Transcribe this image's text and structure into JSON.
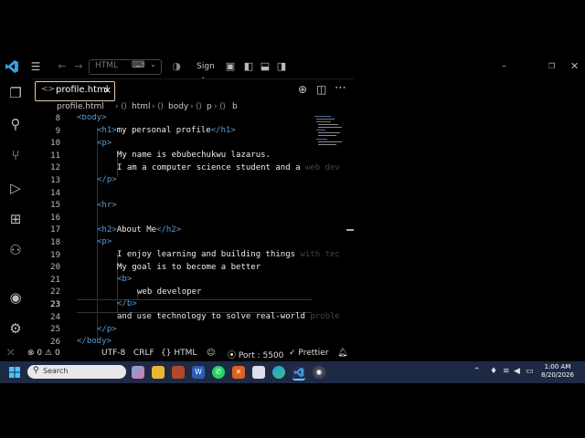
{
  "titlebar": {
    "command_center_label": "HTML",
    "signin_label": "Sign In",
    "icons": [
      "vscode-logo",
      "menu-icon",
      "back-arrow-icon",
      "forward-arrow-icon",
      "copilot-icon",
      "layout-icons",
      "minimize-icon",
      "maximize-icon",
      "close-icon"
    ]
  },
  "activity_bar": [
    "explorer-icon",
    "search-icon",
    "source-control-icon",
    "run-debug-icon",
    "extensions-icon",
    "python-icon",
    "account-icon",
    "settings-gear-icon"
  ],
  "tab": {
    "label": "profile.html",
    "icon": "<>",
    "close": "×"
  },
  "breadcrumb": [
    "profile.html",
    "html",
    "body",
    "p",
    "b"
  ],
  "editor": {
    "lines": [
      {
        "n": "8"
      },
      {
        "n": "9"
      },
      {
        "n": "10"
      },
      {
        "n": "11"
      },
      {
        "n": "12"
      },
      {
        "n": "13"
      },
      {
        "n": "14"
      },
      {
        "n": "15"
      },
      {
        "n": "16"
      },
      {
        "n": "17"
      },
      {
        "n": "18"
      },
      {
        "n": "19"
      },
      {
        "n": "20"
      },
      {
        "n": "21"
      },
      {
        "n": "22"
      },
      {
        "n": "23"
      },
      {
        "n": "24"
      },
      {
        "n": "25"
      },
      {
        "n": "26"
      }
    ],
    "code": {
      "l8_tag": "<body>",
      "l9_open": "<h1>",
      "l9_text": "my personal profile",
      "l9_close": "</h1>",
      "l10": "<p>",
      "l11": "My name is ebubechukwu lazarus.",
      "l12_visible": "I am a computer science student and a ",
      "l12_faded": "web dev",
      "l13": "</p>",
      "l15": "<hr>",
      "l17_open": "<h2>",
      "l17_text": "About Me",
      "l17_close": "</h2>",
      "l18": "<p>",
      "l19_visible": "I enjoy learning and building things ",
      "l19_faded": "with tec",
      "l20": "My goal is to become a better",
      "l21": "<b>",
      "l22": "web developer",
      "l23": "</b>",
      "l24_visible": "and use technology to solve real-world ",
      "l24_faded": "proble",
      "l25": "</p>",
      "l26": "</body>"
    },
    "active_line": "23"
  },
  "statusbar": {
    "errors": "0",
    "warnings": "0",
    "encoding": "UTF-8",
    "eol": "CRLF",
    "language": "HTML",
    "port": "Port : 5500",
    "prettier": "Prettier"
  },
  "taskbar": {
    "search_placeholder": "Search",
    "time": "1:00 AM",
    "date": "8/20/2026"
  }
}
